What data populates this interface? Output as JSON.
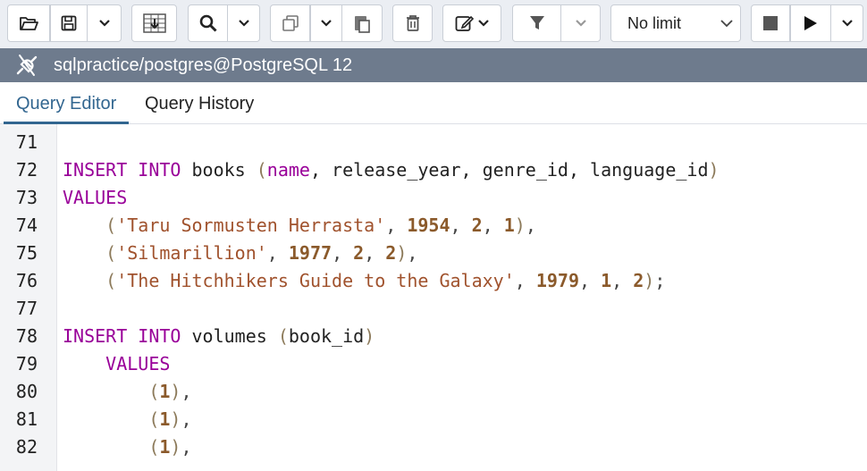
{
  "toolbar": {
    "limit_select": {
      "value": "No limit"
    }
  },
  "connection": {
    "title": "sqlpractice/postgres@PostgreSQL 12"
  },
  "tabs": [
    {
      "label": "Query Editor",
      "active": true
    },
    {
      "label": "Query History",
      "active": false
    }
  ],
  "editor": {
    "partial_line_top": "(       )",
    "lines": [
      {
        "num": "71",
        "tokens": []
      },
      {
        "num": "72",
        "tokens": [
          {
            "t": "INSERT INTO",
            "c": "kw"
          },
          {
            "t": " books ",
            "c": ""
          },
          {
            "t": "(",
            "c": "paren"
          },
          {
            "t": "name",
            "c": "kw"
          },
          {
            "t": ", release_year, genre_id, language_id",
            "c": ""
          },
          {
            "t": ")",
            "c": "paren"
          }
        ]
      },
      {
        "num": "73",
        "tokens": [
          {
            "t": "VALUES",
            "c": "kw"
          }
        ]
      },
      {
        "num": "74",
        "tokens": [
          {
            "t": "    ",
            "c": ""
          },
          {
            "t": "(",
            "c": "paren"
          },
          {
            "t": "'Taru Sormusten Herrasta'",
            "c": "str"
          },
          {
            "t": ", ",
            "c": "pun"
          },
          {
            "t": "1954",
            "c": "num"
          },
          {
            "t": ", ",
            "c": "pun"
          },
          {
            "t": "2",
            "c": "num"
          },
          {
            "t": ", ",
            "c": "pun"
          },
          {
            "t": "1",
            "c": "num"
          },
          {
            "t": ")",
            "c": "paren"
          },
          {
            "t": ",",
            "c": "pun"
          }
        ]
      },
      {
        "num": "75",
        "tokens": [
          {
            "t": "    ",
            "c": ""
          },
          {
            "t": "(",
            "c": "paren"
          },
          {
            "t": "'Silmarillion'",
            "c": "str"
          },
          {
            "t": ", ",
            "c": "pun"
          },
          {
            "t": "1977",
            "c": "num"
          },
          {
            "t": ", ",
            "c": "pun"
          },
          {
            "t": "2",
            "c": "num"
          },
          {
            "t": ", ",
            "c": "pun"
          },
          {
            "t": "2",
            "c": "num"
          },
          {
            "t": ")",
            "c": "paren"
          },
          {
            "t": ",",
            "c": "pun"
          }
        ]
      },
      {
        "num": "76",
        "tokens": [
          {
            "t": "    ",
            "c": ""
          },
          {
            "t": "(",
            "c": "paren"
          },
          {
            "t": "'The Hitchhikers Guide to the Galaxy'",
            "c": "str"
          },
          {
            "t": ", ",
            "c": "pun"
          },
          {
            "t": "1979",
            "c": "num"
          },
          {
            "t": ", ",
            "c": "pun"
          },
          {
            "t": "1",
            "c": "num"
          },
          {
            "t": ", ",
            "c": "pun"
          },
          {
            "t": "2",
            "c": "num"
          },
          {
            "t": ")",
            "c": "paren"
          },
          {
            "t": ";",
            "c": "pun"
          }
        ]
      },
      {
        "num": "77",
        "tokens": []
      },
      {
        "num": "78",
        "tokens": [
          {
            "t": "INSERT INTO",
            "c": "kw"
          },
          {
            "t": " volumes ",
            "c": ""
          },
          {
            "t": "(",
            "c": "paren"
          },
          {
            "t": "book_id",
            "c": ""
          },
          {
            "t": ")",
            "c": "paren"
          }
        ]
      },
      {
        "num": "79",
        "tokens": [
          {
            "t": "    ",
            "c": ""
          },
          {
            "t": "VALUES",
            "c": "kw"
          }
        ]
      },
      {
        "num": "80",
        "tokens": [
          {
            "t": "        ",
            "c": ""
          },
          {
            "t": "(",
            "c": "paren"
          },
          {
            "t": "1",
            "c": "num"
          },
          {
            "t": ")",
            "c": "paren"
          },
          {
            "t": ",",
            "c": "pun"
          }
        ]
      },
      {
        "num": "81",
        "tokens": [
          {
            "t": "        ",
            "c": ""
          },
          {
            "t": "(",
            "c": "paren"
          },
          {
            "t": "1",
            "c": "num"
          },
          {
            "t": ")",
            "c": "paren"
          },
          {
            "t": ",",
            "c": "pun"
          }
        ]
      },
      {
        "num": "82",
        "tokens": [
          {
            "t": "        ",
            "c": ""
          },
          {
            "t": "(",
            "c": "paren"
          },
          {
            "t": "1",
            "c": "num"
          },
          {
            "t": ")",
            "c": "paren"
          },
          {
            "t": ",",
            "c": "pun"
          }
        ]
      }
    ]
  }
}
